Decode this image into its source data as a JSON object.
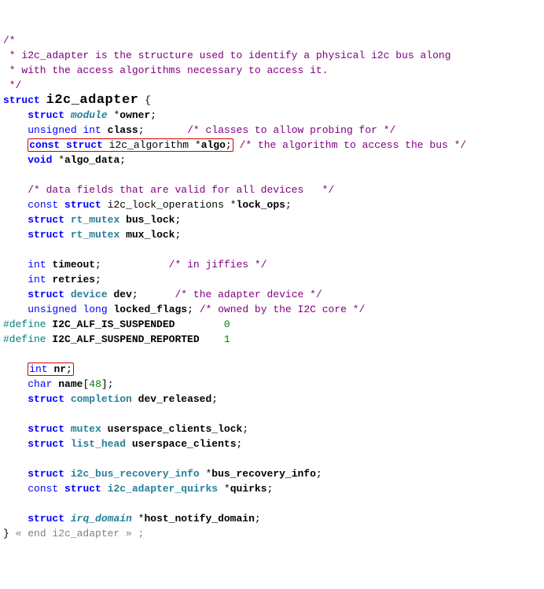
{
  "c": {
    "b1": "/*",
    "b2": " * i2c_adapter is the structure used to identify a physical i2c bus along",
    "b3": " * with the access algorithms necessary to access it.",
    "b4": " */",
    "classes": "/* classes to allow probing for */",
    "algo": "/* the algorithm to access the bus */",
    "datafields": "/* data fields that are valid for all devices   */",
    "jiffies": "/* in jiffies */",
    "adapterdev": "/* the adapter device */",
    "owned": "/* owned by the I2C core */",
    "end": "« end i2c_adapter » ;"
  },
  "kw": {
    "struct": "struct",
    "const": "const",
    "void": "void",
    "int": "int",
    "char": "char",
    "unsigned": "unsigned",
    "long": "long",
    "define": "#define"
  },
  "t": {
    "i2c_adapter": "i2c_adapter",
    "module": "module",
    "i2c_algorithm": "i2c_algorithm",
    "i2c_lock_operations": "i2c_lock_operations",
    "rt_mutex": "rt_mutex",
    "device": "device",
    "completion": "completion",
    "mutex": "mutex",
    "list_head": "list_head",
    "i2c_bus_recovery_info": "i2c_bus_recovery_info",
    "i2c_adapter_quirks": "i2c_adapter_quirks",
    "irq_domain": "irq_domain"
  },
  "f": {
    "owner": "owner",
    "class": "class",
    "algo": "algo",
    "algo_data": "algo_data",
    "lock_ops": "lock_ops",
    "bus_lock": "bus_lock",
    "mux_lock": "mux_lock",
    "timeout": "timeout",
    "retries": "retries",
    "dev": "dev",
    "locked_flags": "locked_flags",
    "nr": "nr",
    "name": "name",
    "dev_released": "dev_released",
    "userspace_clients_lock": "userspace_clients_lock",
    "userspace_clients": "userspace_clients",
    "bus_recovery_info": "bus_recovery_info",
    "quirks": "quirks",
    "host_notify_domain": "host_notify_domain"
  },
  "d": {
    "sus": "I2C_ALF_IS_SUSPENDED",
    "rep": "I2C_ALF_SUSPEND_REPORTED",
    "zero": "0",
    "one": "1",
    "arr48": "48"
  }
}
